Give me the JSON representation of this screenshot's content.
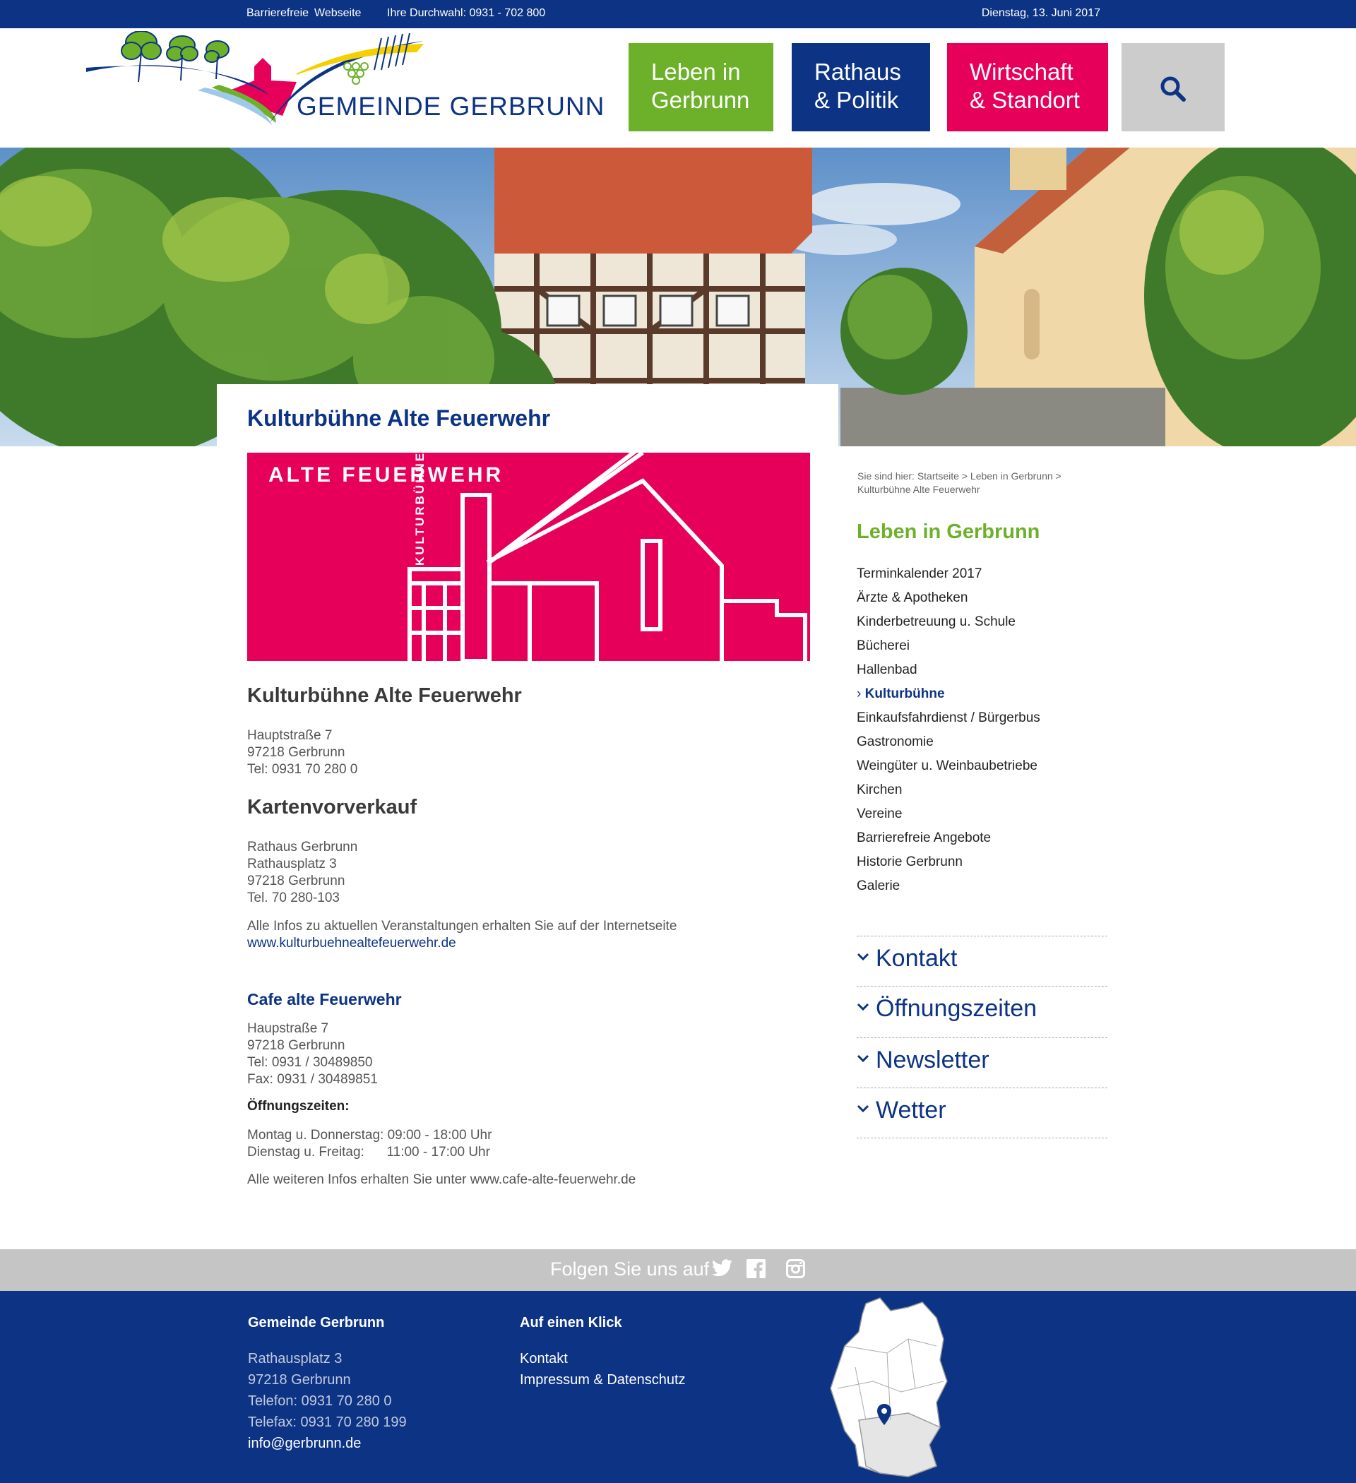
{
  "topbar": {
    "accessibility": "Barrierefreie",
    "accessibility_2": "Webseite",
    "phone": "Ihre Durchwahl: 0931 - 702 800",
    "date": "Dienstag, 13. Juni 2017"
  },
  "header": {
    "logo_text": "GEMEINDE GERBRUNN",
    "nav": [
      {
        "line1": "Leben in",
        "line2": "Gerbrunn",
        "color": "#6db12a"
      },
      {
        "line1": "Rathaus",
        "line2": "& Politik",
        "color": "#0c3384"
      },
      {
        "line1": "Wirtschaft",
        "line2": "& Standort",
        "color": "#e6005a"
      }
    ],
    "search_icon": "search-icon"
  },
  "page": {
    "title": "Kulturbühne Alte Feuerwehr",
    "banner": {
      "text_main": "ALTE FEUERWEHR",
      "text_vertical": "KULTURBÜHNE"
    },
    "section1": {
      "heading": "Kulturbühne Alte Feuerwehr",
      "address": [
        "Hauptstraße 7",
        "97218 Gerbrunn",
        "Tel: 0931 70 280 0"
      ]
    },
    "section2": {
      "heading": "Kartenvorverkauf",
      "address": [
        "Rathaus Gerbrunn",
        "Rathausplatz 3",
        "97218 Gerbrunn",
        "Tel. 70 280-103"
      ],
      "info": "Alle Infos zu aktuellen Veranstaltungen erhalten Sie auf der Internetseite",
      "link": "www.kulturbuehnealtefeuerwehr.de"
    },
    "section3": {
      "heading": "Cafe alte Feuerwehr",
      "address": [
        "Haupstraße 7",
        "97218 Gerbrunn",
        "Tel: 0931 / 30489850",
        "Fax: 0931 / 30489851"
      ],
      "hours_label": "Öffnungszeiten:",
      "hours": [
        "Montag u. Donnerstag: 09:00 - 18:00 Uhr",
        "Dienstag u. Freitag:      11:00 - 17:00 Uhr"
      ],
      "more": "Alle weiteren Infos erhalten Sie unter www.cafe-alte-feuerwehr.de"
    }
  },
  "sidebar": {
    "breadcrumb_line1": "Sie sind hier: Startseite > Leben in Gerbrunn >",
    "breadcrumb_line2": "Kulturbühne Alte Feuerwehr",
    "title": "Leben in Gerbrunn",
    "items": [
      {
        "label": "Terminkalender 2017"
      },
      {
        "label": "Ärzte & Apotheken"
      },
      {
        "label": "Kinderbetreuung u. Schule"
      },
      {
        "label": "Bücherei"
      },
      {
        "label": "Hallenbad"
      },
      {
        "label": "Kulturbühne",
        "active": true
      },
      {
        "label": "Einkaufsfahrdienst / Bürgerbus"
      },
      {
        "label": "Gastronomie"
      },
      {
        "label": "Weingüter u. Weinbaubetriebe"
      },
      {
        "label": "Kirchen"
      },
      {
        "label": "Vereine"
      },
      {
        "label": "Barrierefreie Angebote"
      },
      {
        "label": "Historie Gerbrunn"
      },
      {
        "label": "Galerie"
      }
    ],
    "accordion": [
      {
        "label": "Kontakt"
      },
      {
        "label": "Öffnungszeiten"
      },
      {
        "label": "Newsletter"
      },
      {
        "label": "Wetter"
      }
    ]
  },
  "follow": {
    "text": "Folgen Sie uns auf",
    "icons": [
      "twitter-icon",
      "facebook-icon",
      "instagram-icon"
    ]
  },
  "footer": {
    "col1": {
      "heading": "Gemeinde Gerbrunn",
      "lines": [
        "Rathausplatz 3",
        "97218 Gerbrunn",
        "Telefon: 0931 70 280 0",
        "Telefax: 0931 70 280 199"
      ],
      "email": "info@gerbrunn.de"
    },
    "col2": {
      "heading": "Auf einen Klick",
      "links": [
        "Kontakt",
        "Impressum & Datenschutz"
      ]
    }
  },
  "colors": {
    "brand_blue": "#0c3384",
    "green": "#6db12a",
    "magenta": "#e6005a",
    "grey": "#cccccc"
  }
}
